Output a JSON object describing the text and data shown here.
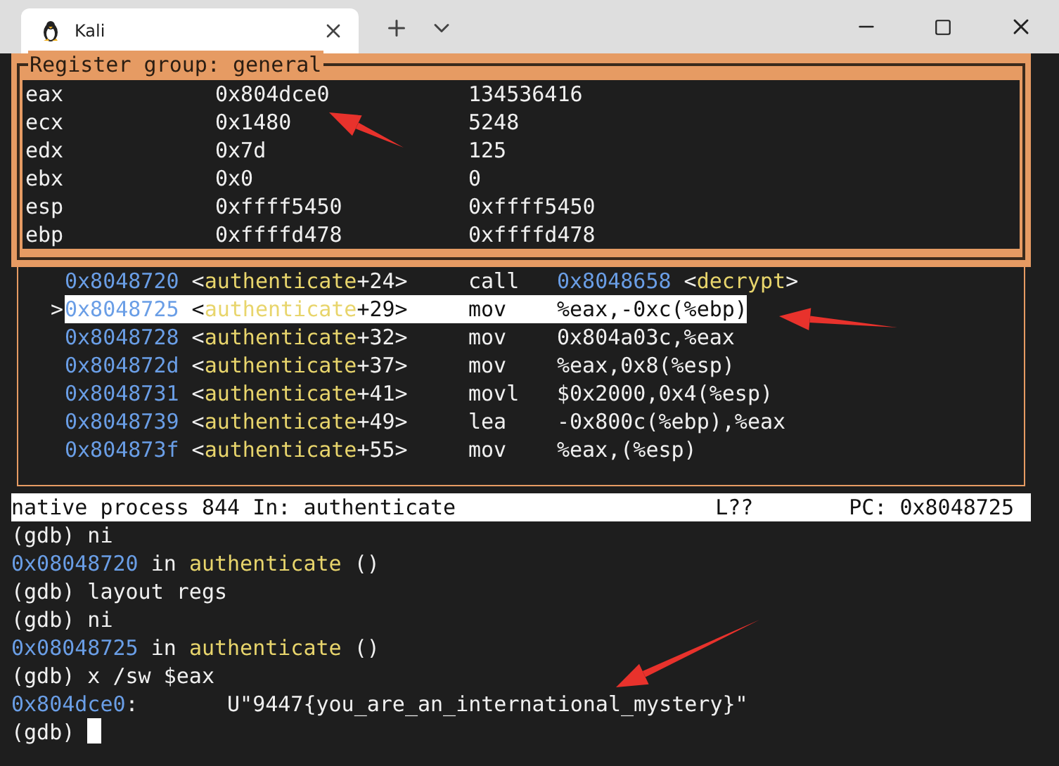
{
  "window": {
    "tab_title": "Kali"
  },
  "registers": {
    "title": "Register group: general",
    "rows": [
      {
        "name": "eax",
        "hex": "0x804dce0",
        "natural": "134536416"
      },
      {
        "name": "ecx",
        "hex": "0x1480",
        "natural": "5248"
      },
      {
        "name": "edx",
        "hex": "0x7d",
        "natural": "125"
      },
      {
        "name": "ebx",
        "hex": "0x0",
        "natural": "0"
      },
      {
        "name": "esp",
        "hex": "0xffff5450",
        "natural": "0xffff5450"
      },
      {
        "name": "ebp",
        "hex": "0xffffd478",
        "natural": "0xffffd478"
      }
    ]
  },
  "assembly": {
    "pointer": ">",
    "rows": [
      {
        "selected": false,
        "location": [
          {
            "kind": "address",
            "text": "0x8048720"
          },
          {
            "kind": "plain",
            "text": " <"
          },
          {
            "kind": "symbol",
            "text": "authenticate"
          },
          {
            "kind": "plain",
            "text": "+24>"
          }
        ],
        "mnemonic": "call",
        "operands": [
          {
            "kind": "address",
            "text": "0x8048658"
          },
          {
            "kind": "plain",
            "text": " <"
          },
          {
            "kind": "symbol",
            "text": "decrypt"
          },
          {
            "kind": "plain",
            "text": ">"
          }
        ]
      },
      {
        "selected": true,
        "location": [
          {
            "kind": "address",
            "text": "0x8048725"
          },
          {
            "kind": "plain",
            "text": " <"
          },
          {
            "kind": "symbol",
            "text": "authenticate"
          },
          {
            "kind": "plain",
            "text": "+29>"
          }
        ],
        "mnemonic": "mov",
        "operands": [
          {
            "kind": "plain",
            "text": "%eax,-0xc(%ebp)"
          }
        ]
      },
      {
        "selected": false,
        "location": [
          {
            "kind": "address",
            "text": "0x8048728"
          },
          {
            "kind": "plain",
            "text": " <"
          },
          {
            "kind": "symbol",
            "text": "authenticate"
          },
          {
            "kind": "plain",
            "text": "+32>"
          }
        ],
        "mnemonic": "mov",
        "operands": [
          {
            "kind": "plain",
            "text": "0x804a03c,%eax"
          }
        ]
      },
      {
        "selected": false,
        "location": [
          {
            "kind": "address",
            "text": "0x804872d"
          },
          {
            "kind": "plain",
            "text": " <"
          },
          {
            "kind": "symbol",
            "text": "authenticate"
          },
          {
            "kind": "plain",
            "text": "+37>"
          }
        ],
        "mnemonic": "mov",
        "operands": [
          {
            "kind": "plain",
            "text": "%eax,0x8(%esp)"
          }
        ]
      },
      {
        "selected": false,
        "location": [
          {
            "kind": "address",
            "text": "0x8048731"
          },
          {
            "kind": "plain",
            "text": " <"
          },
          {
            "kind": "symbol",
            "text": "authenticate"
          },
          {
            "kind": "plain",
            "text": "+41>"
          }
        ],
        "mnemonic": "movl",
        "operands": [
          {
            "kind": "plain",
            "text": "$0x2000,0x4(%esp)"
          }
        ]
      },
      {
        "selected": false,
        "location": [
          {
            "kind": "address",
            "text": "0x8048739"
          },
          {
            "kind": "plain",
            "text": " <"
          },
          {
            "kind": "symbol",
            "text": "authenticate"
          },
          {
            "kind": "plain",
            "text": "+49>"
          }
        ],
        "mnemonic": "lea",
        "operands": [
          {
            "kind": "plain",
            "text": "-0x800c(%ebp),%eax"
          }
        ]
      },
      {
        "selected": false,
        "location": [
          {
            "kind": "address",
            "text": "0x804873f"
          },
          {
            "kind": "plain",
            "text": " <"
          },
          {
            "kind": "symbol",
            "text": "authenticate"
          },
          {
            "kind": "plain",
            "text": "+55>"
          }
        ],
        "mnemonic": "mov",
        "operands": [
          {
            "kind": "plain",
            "text": "%eax,(%esp)"
          }
        ]
      }
    ]
  },
  "status_bar": {
    "process": "native process 844 In: authenticate",
    "line": "L??",
    "pc": "PC: 0x8048725"
  },
  "console": {
    "lines": [
      [
        {
          "kind": "plain",
          "text": "(gdb) ni"
        }
      ],
      [
        {
          "kind": "address",
          "text": "0x08048720"
        },
        {
          "kind": "plain",
          "text": " in "
        },
        {
          "kind": "symbol",
          "text": "authenticate"
        },
        {
          "kind": "plain",
          "text": " ()"
        }
      ],
      [
        {
          "kind": "plain",
          "text": "(gdb) layout regs"
        }
      ],
      [
        {
          "kind": "plain",
          "text": "(gdb) ni"
        }
      ],
      [
        {
          "kind": "address",
          "text": "0x08048725"
        },
        {
          "kind": "plain",
          "text": " in "
        },
        {
          "kind": "symbol",
          "text": "authenticate"
        },
        {
          "kind": "plain",
          "text": " ()"
        }
      ],
      [
        {
          "kind": "plain",
          "text": "(gdb) x /sw $eax"
        }
      ],
      [
        {
          "kind": "address",
          "text": "0x804dce0"
        },
        {
          "kind": "plain",
          "text": ":       U\"9447{you_are_an_international_mystery}\""
        }
      ]
    ],
    "prompt": "(gdb)"
  }
}
